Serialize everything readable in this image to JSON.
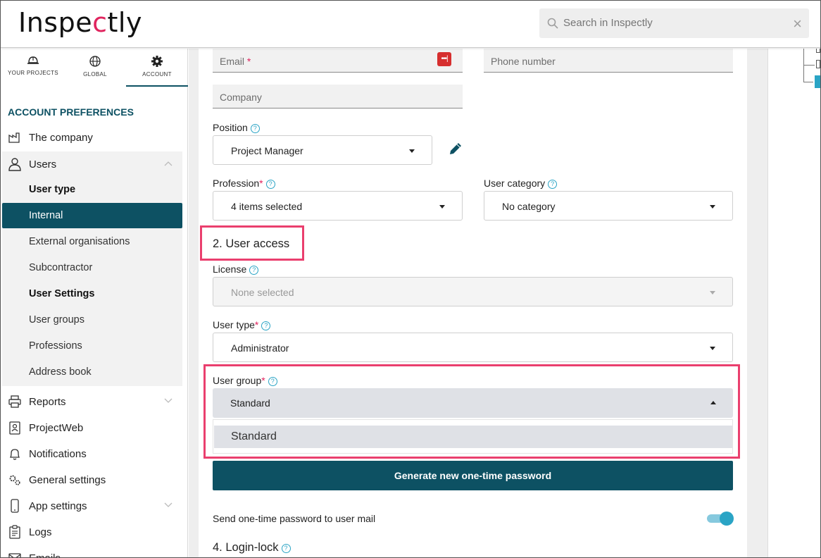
{
  "app": {
    "logo_prefix": "Inspe",
    "logo_accent": "c",
    "logo_suffix": "tly"
  },
  "search": {
    "placeholder": "Search in Inspectly",
    "close": "×"
  },
  "tabs": [
    {
      "label": "YOUR PROJECTS",
      "icon": "helmet-icon"
    },
    {
      "label": "GLOBAL",
      "icon": "globe-icon"
    },
    {
      "label": "ACCOUNT",
      "icon": "gear-icon",
      "active": true
    }
  ],
  "sidebar": {
    "section_title": "ACCOUNT PREFERENCES",
    "items": {
      "company": "The company",
      "users": "Users",
      "reports": "Reports",
      "projectweb": "ProjectWeb",
      "notifications": "Notifications",
      "general_settings": "General settings",
      "app_settings": "App settings",
      "logs": "Logs",
      "emails": "Emails"
    },
    "users_sub": {
      "user_type": "User type",
      "internal": "Internal",
      "external": "External organisations",
      "subcontractor": "Subcontractor",
      "user_settings": "User Settings",
      "user_groups": "User groups",
      "professions": "Professions",
      "address_book": "Address book"
    }
  },
  "form": {
    "email_ph": "Email",
    "phone_ph": "Phone number",
    "company_ph": "Company",
    "lastpass_icon": "•••|",
    "position": {
      "label": "Position",
      "value": "Project Manager"
    },
    "profession": {
      "label": "Profession",
      "value": "4 items selected"
    },
    "user_category": {
      "label": "User category",
      "value": "No category"
    },
    "section_access": "2. User access",
    "license": {
      "label": "License",
      "value": "None selected"
    },
    "user_type": {
      "label": "User type",
      "value": "Administrator"
    },
    "user_group": {
      "label": "User group",
      "value": "Standard",
      "options": [
        "Standard"
      ]
    },
    "generate_btn": "Generate new one-time password",
    "send_otp_label": "Send one-time password to user mail",
    "send_otp_enabled": true,
    "section_login_lock": "4. Login-lock",
    "required_mark": "*",
    "help_mark": "?"
  },
  "colors": {
    "brand": "#0d5163",
    "accent": "#e0245e",
    "highlight": "#ea3f6e",
    "toggle": "#2aa4c5"
  }
}
